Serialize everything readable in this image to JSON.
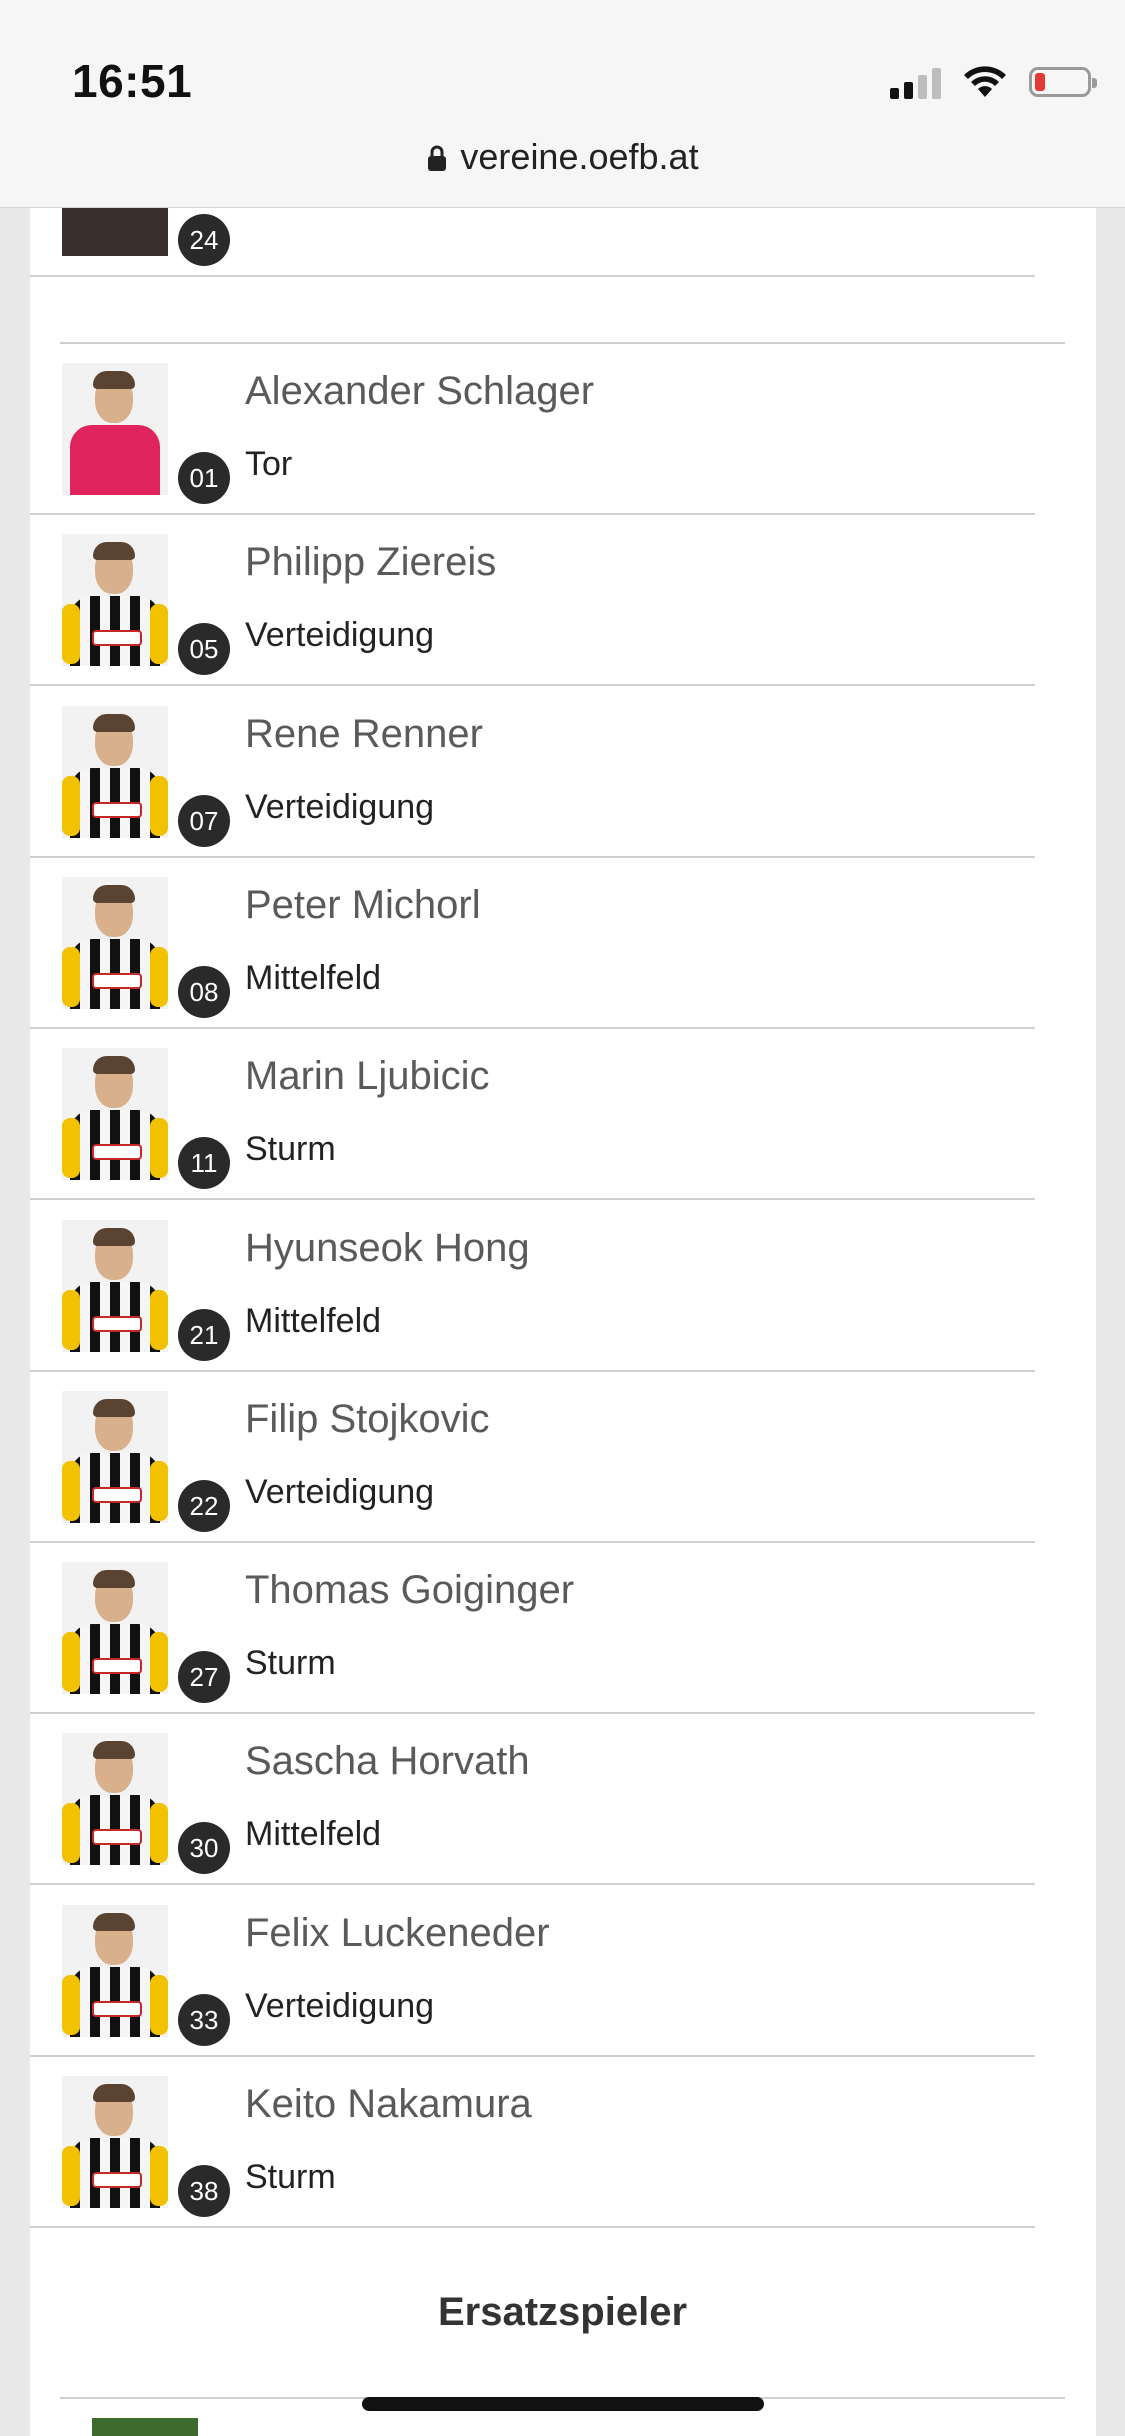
{
  "status_bar": {
    "time": "16:51"
  },
  "browser": {
    "url": "vereine.oefb.at"
  },
  "partial_top_player": {
    "number": "24"
  },
  "players": [
    {
      "name": "Alexander Schlager",
      "position": "Tor",
      "number": "01",
      "kit": "keeper"
    },
    {
      "name": "Philipp Ziereis",
      "position": "Verteidigung",
      "number": "05",
      "kit": "outfield"
    },
    {
      "name": "Rene Renner",
      "position": "Verteidigung",
      "number": "07",
      "kit": "outfield"
    },
    {
      "name": "Peter Michorl",
      "position": "Mittelfeld",
      "number": "08",
      "kit": "outfield"
    },
    {
      "name": "Marin Ljubicic",
      "position": "Sturm",
      "number": "11",
      "kit": "outfield"
    },
    {
      "name": "Hyunseok Hong",
      "position": "Mittelfeld",
      "number": "21",
      "kit": "outfield"
    },
    {
      "name": "Filip Stojkovic",
      "position": "Verteidigung",
      "number": "22",
      "kit": "outfield"
    },
    {
      "name": "Thomas Goiginger",
      "position": "Sturm",
      "number": "27",
      "kit": "outfield"
    },
    {
      "name": "Sascha Horvath",
      "position": "Mittelfeld",
      "number": "30",
      "kit": "outfield"
    },
    {
      "name": "Felix Luckeneder",
      "position": "Verteidigung",
      "number": "33",
      "kit": "outfield"
    },
    {
      "name": "Keito Nakamura",
      "position": "Sturm",
      "number": "38",
      "kit": "outfield"
    }
  ],
  "section": {
    "title": "Ersatzspieler"
  }
}
